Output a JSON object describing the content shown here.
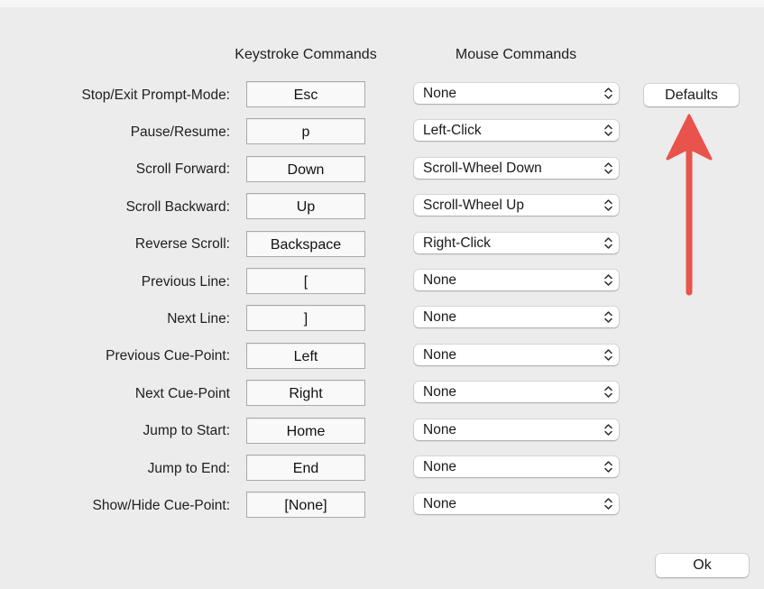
{
  "headers": {
    "keystroke": "Keystroke Commands",
    "mouse": "Mouse Commands"
  },
  "rows": [
    {
      "label": "Stop/Exit Prompt-Mode:",
      "key": "Esc",
      "mouse": "None"
    },
    {
      "label": "Pause/Resume:",
      "key": "p",
      "mouse": "Left-Click"
    },
    {
      "label": "Scroll Forward:",
      "key": "Down",
      "mouse": "Scroll-Wheel Down"
    },
    {
      "label": "Scroll Backward:",
      "key": "Up",
      "mouse": "Scroll-Wheel Up"
    },
    {
      "label": "Reverse Scroll:",
      "key": "Backspace",
      "mouse": "Right-Click"
    },
    {
      "label": "Previous Line:",
      "key": "[",
      "mouse": "None"
    },
    {
      "label": "Next Line:",
      "key": "]",
      "mouse": "None"
    },
    {
      "label": "Previous Cue-Point:",
      "key": "Left",
      "mouse": "None"
    },
    {
      "label": "Next Cue-Point",
      "key": "Right",
      "mouse": "None"
    },
    {
      "label": "Jump to Start:",
      "key": "Home",
      "mouse": "None"
    },
    {
      "label": "Jump to End:",
      "key": "End",
      "mouse": "None"
    },
    {
      "label": "Show/Hide Cue-Point:",
      "key": "[None]",
      "mouse": "None"
    }
  ],
  "buttons": {
    "defaults": "Defaults",
    "ok": "Ok"
  },
  "annotation": {
    "arrow_color": "#e8534b",
    "arrow_icon": "red-arrow-up-icon"
  },
  "icons": {
    "select_indicator": "up-down-chevron-icon"
  }
}
